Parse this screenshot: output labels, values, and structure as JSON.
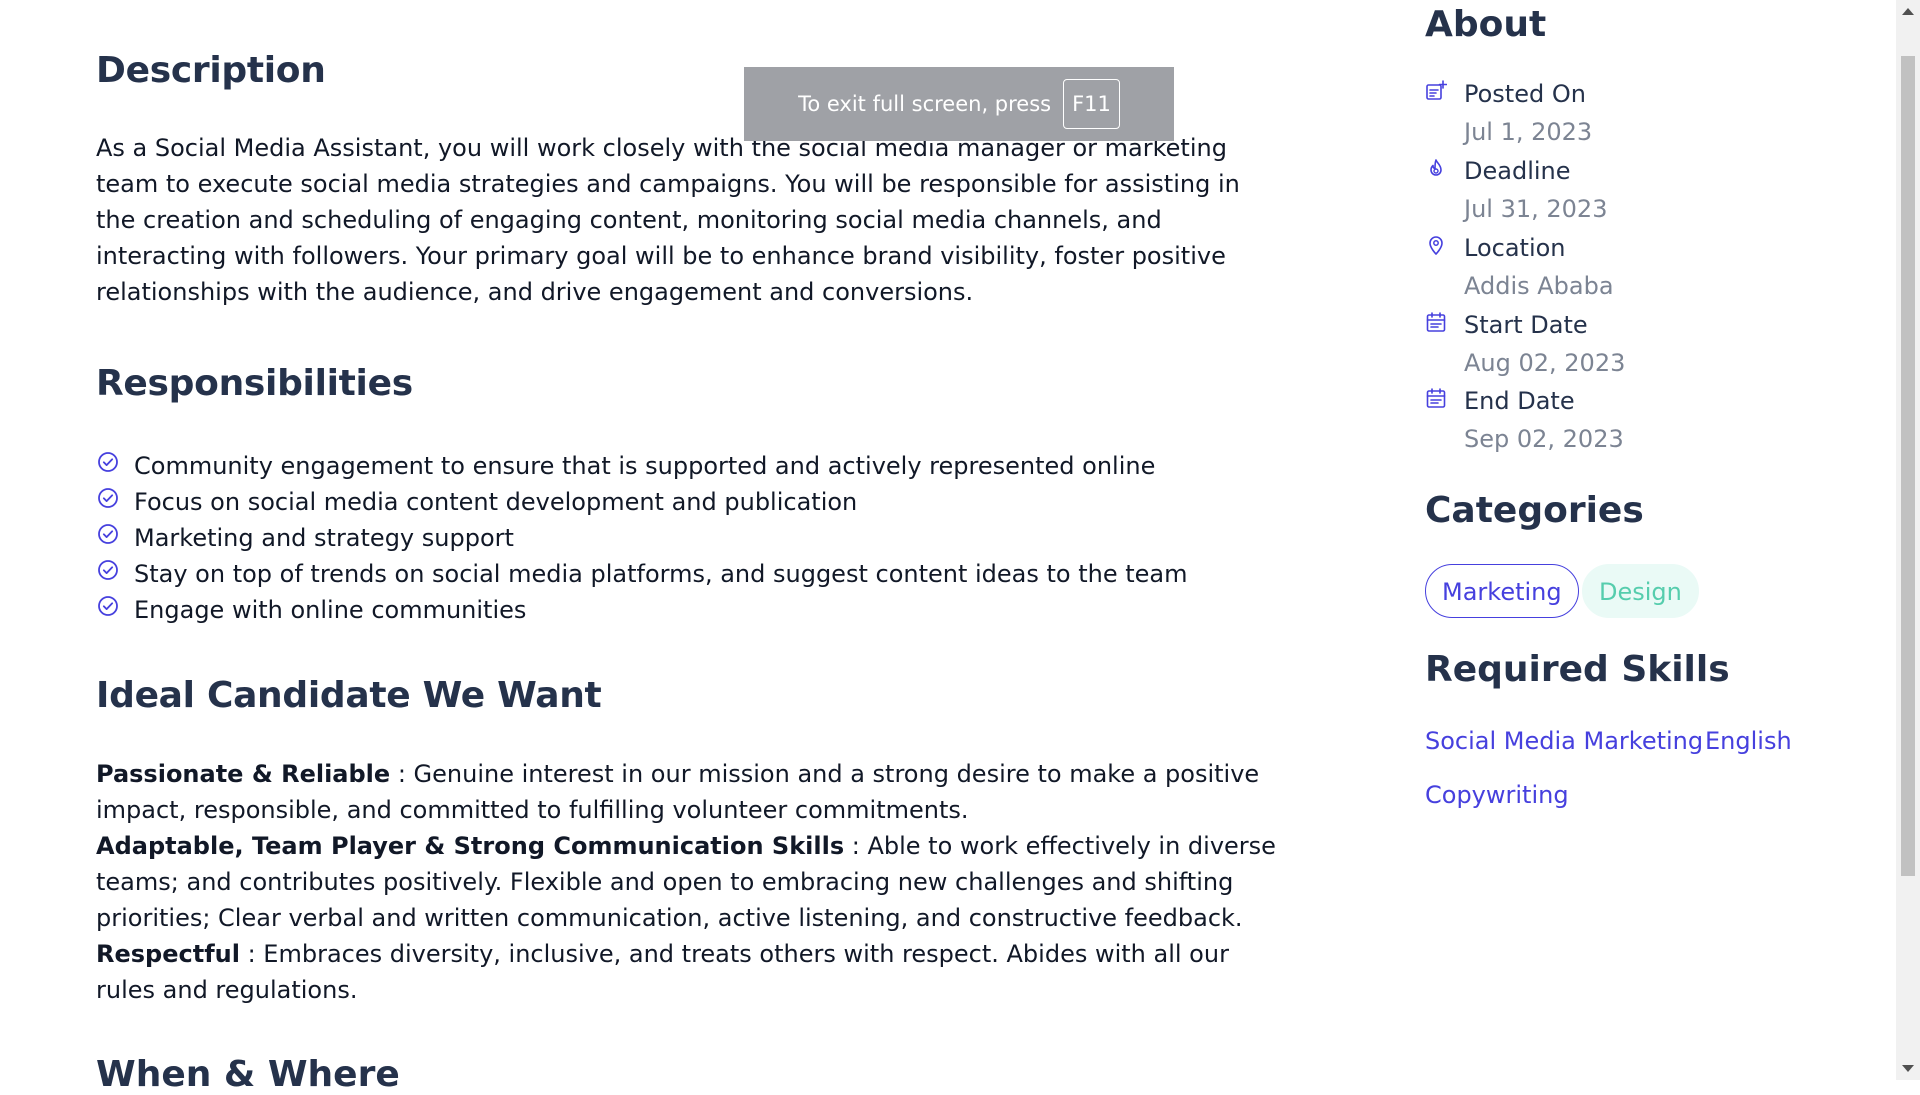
{
  "description": {
    "title": "Description",
    "text": "As a Social Media Assistant, you will work closely with the social media manager or marketing team to execute social media strategies and campaigns. You will be responsible for assisting in the creation and scheduling of engaging content, monitoring social media channels, and interacting with followers. Your primary goal will be to enhance brand visibility, foster positive relationships with the audience, and drive engagement and conversions."
  },
  "responsibilities": {
    "title": "Responsibilities",
    "items": [
      "Community engagement to ensure that is supported and actively represented online",
      "Focus on social media content development and publication",
      "Marketing and strategy support",
      "Stay on top of trends on social media platforms, and suggest content ideas to the team",
      "Engage with online communities"
    ]
  },
  "ideal_candidate": {
    "title": "Ideal Candidate We Want",
    "traits": [
      {
        "name": "Passionate & Reliable",
        "text": " : Genuine interest in our mission and a strong desire to make a positive impact, responsible, and committed to fulfilling volunteer commitments."
      },
      {
        "name": "Adaptable, Team Player & Strong Communication Skills",
        "text": " : Able to work effectively in diverse teams; and contributes positively. Flexible and open to embracing new challenges and shifting priorities; Clear verbal and written communication, active listening, and constructive feedback."
      },
      {
        "name": "Respectful",
        "text": " : Embraces diversity, inclusive, and treats others with respect. Abides with all our rules and regulations."
      }
    ]
  },
  "when_where": {
    "title": "When & Where"
  },
  "about": {
    "title": "About",
    "items": [
      {
        "label": "Posted On",
        "value": "Jul 1, 2023",
        "icon": "calendar-plus-icon"
      },
      {
        "label": "Deadline",
        "value": "Jul 31, 2023",
        "icon": "fire-icon"
      },
      {
        "label": "Location",
        "value": "Addis Ababa",
        "icon": "location-pin-icon"
      },
      {
        "label": "Start Date",
        "value": "Aug 02, 2023",
        "icon": "calendar-icon"
      },
      {
        "label": "End Date",
        "value": "Sep 02, 2023",
        "icon": "calendar-icon"
      }
    ]
  },
  "categories": {
    "title": "Categories",
    "items": [
      "Marketing",
      "Design"
    ]
  },
  "skills": {
    "title": "Required Skills",
    "items": [
      "Social Media Marketing",
      "English",
      "Copywriting"
    ]
  },
  "fullscreen_toast": {
    "text": "To exit full screen, press",
    "key": "F11"
  },
  "colors": {
    "heading": "#25324b",
    "accent": "#4640de",
    "muted": "#7c8493",
    "design_chip_bg": "#eafaf6",
    "design_chip_text": "#56cdad"
  }
}
